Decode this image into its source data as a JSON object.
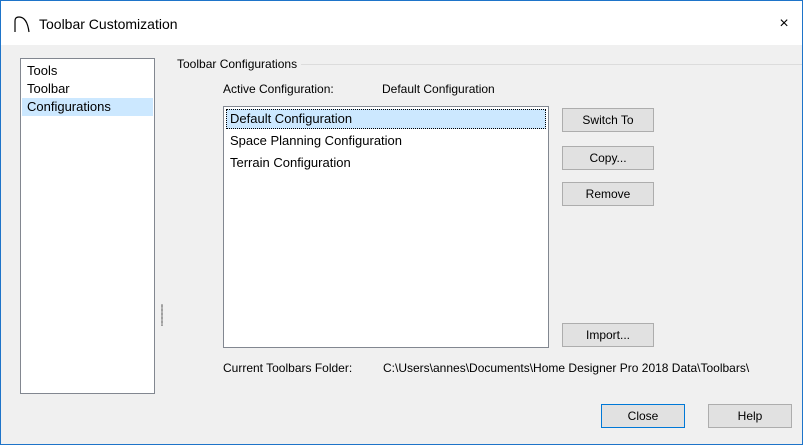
{
  "window": {
    "title": "Toolbar Customization",
    "close_glyph": "×"
  },
  "nav": {
    "items": [
      {
        "label": "Tools"
      },
      {
        "label": "Toolbar"
      },
      {
        "label": "Configurations"
      }
    ]
  },
  "group": {
    "title": "Toolbar Configurations"
  },
  "active": {
    "label": "Active Configuration:",
    "value": "Default Configuration"
  },
  "configs": [
    {
      "label": "Default Configuration"
    },
    {
      "label": "Space Planning Configuration"
    },
    {
      "label": "Terrain Configuration"
    }
  ],
  "buttons": {
    "switch_to": "Switch To",
    "copy": "Copy...",
    "remove": "Remove",
    "import": "Import...",
    "close": "Close",
    "help": "Help"
  },
  "folder": {
    "label": "Current Toolbars Folder:",
    "value": "C:\\Users\\annes\\Documents\\Home Designer Pro 2018 Data\\Toolbars\\"
  },
  "colors": {
    "selection": "#cce8ff",
    "window_border": "#1e74c9",
    "default_button_border": "#0078d7"
  }
}
